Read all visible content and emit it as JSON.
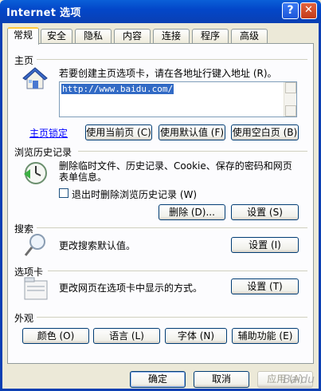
{
  "window": {
    "title": "Internet 选项",
    "help": "?",
    "close": "✕"
  },
  "tabs": [
    "常规",
    "安全",
    "隐私",
    "内容",
    "连接",
    "程序",
    "高级"
  ],
  "home": {
    "group": "主页",
    "desc": "若要创建主页选项卡，请在各地址行键入地址 (R)。",
    "url": "http://www.baidu.com/",
    "lock_link": "主页锁定",
    "btn_current": "使用当前页 (C)",
    "btn_default": "使用默认值 (F)",
    "btn_blank": "使用空白页 (B)"
  },
  "history": {
    "group": "浏览历史记录",
    "desc_line1": "删除临时文件、历史记录、Cookie、保存的密码和网页",
    "desc_line2": "表单信息。",
    "checkbox_label": "退出时删除浏览历史记录 (W)",
    "btn_delete": "删除 (D)...",
    "btn_settings": "设置 (S)"
  },
  "search": {
    "group": "搜索",
    "desc": "更改搜索默认值。",
    "btn_settings": "设置 (I)"
  },
  "tabs_section": {
    "group": "选项卡",
    "desc": "更改网页在选项卡中显示的方式。",
    "btn_settings": "设置 (T)"
  },
  "appearance": {
    "group": "外观",
    "btn_colors": "颜色 (O)",
    "btn_languages": "语言 (L)",
    "btn_fonts": "字体 (N)",
    "btn_accessibility": "辅助功能 (E)"
  },
  "bottom": {
    "ok": "确定",
    "cancel": "取消",
    "apply": "应用 (A)"
  },
  "watermark": "Baidu"
}
